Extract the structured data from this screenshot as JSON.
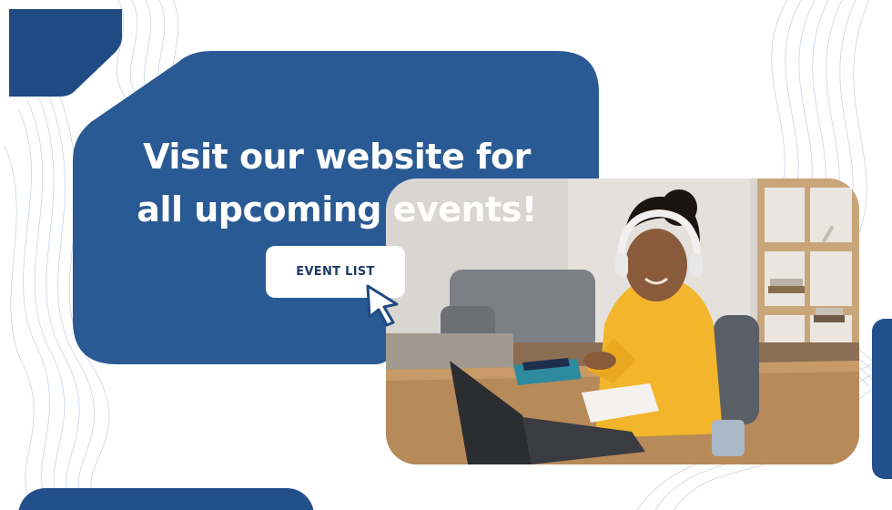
{
  "banner": {
    "headline_line1": "Visit our website for",
    "headline_line2": "all upcoming events!",
    "cta_label": "EVENT LIST"
  },
  "colors": {
    "brand_blue": "#2a5a93",
    "dark_blue": "#1f4a84",
    "background": "#ffffff",
    "line_pattern": "#b9c6d8",
    "hoodie": "#f2b52c"
  },
  "icons": {
    "cursor": "pointer-cursor-icon"
  }
}
